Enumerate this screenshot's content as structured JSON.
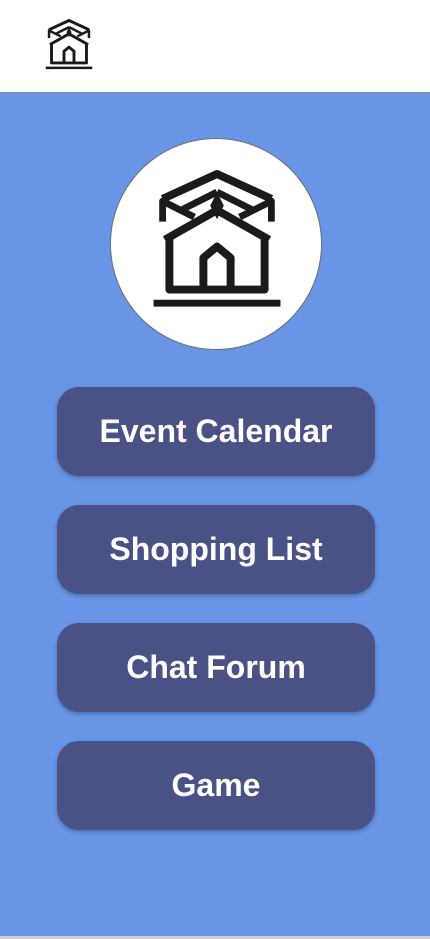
{
  "header": {
    "logo_icon": "home-crown-logo-icon"
  },
  "profile": {
    "avatar_icon": "home-crown-logo-icon"
  },
  "menu": {
    "items": [
      {
        "label": "Event Calendar"
      },
      {
        "label": "Shopping List"
      },
      {
        "label": "Chat Forum"
      },
      {
        "label": "Game"
      }
    ]
  },
  "colors": {
    "background": "#6895e6",
    "button": "#4a5185",
    "button_text": "#ffffff"
  }
}
